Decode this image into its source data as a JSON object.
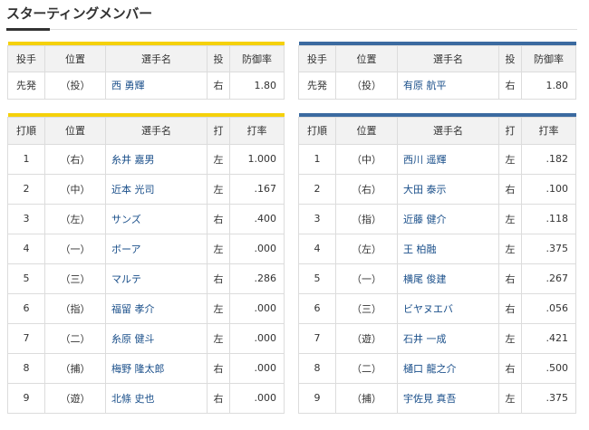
{
  "page": {
    "title": "スターティングメンバー"
  },
  "colors": {
    "home": "#f5d10a",
    "away": "#3b6aa0"
  },
  "pitchers": {
    "headers": [
      "投手",
      "位置",
      "選手名",
      "投",
      "防御率"
    ],
    "home": [
      [
        "先発",
        "（投）",
        "西 勇輝",
        "右",
        "1.80"
      ]
    ],
    "away": [
      [
        "先発",
        "（投）",
        "有原 航平",
        "右",
        "1.80"
      ]
    ]
  },
  "lineup": {
    "headers": [
      "打順",
      "位置",
      "選手名",
      "打",
      "打率"
    ],
    "home": [
      [
        "1",
        "（右）",
        "糸井 嘉男",
        "左",
        "1.000"
      ],
      [
        "2",
        "（中）",
        "近本 光司",
        "左",
        ".167"
      ],
      [
        "3",
        "（左）",
        "サンズ",
        "右",
        ".400"
      ],
      [
        "4",
        "（一）",
        "ボーア",
        "左",
        ".000"
      ],
      [
        "5",
        "（三）",
        "マルテ",
        "右",
        ".286"
      ],
      [
        "6",
        "（指）",
        "福留 孝介",
        "左",
        ".000"
      ],
      [
        "7",
        "（二）",
        "糸原 健斗",
        "左",
        ".000"
      ],
      [
        "8",
        "（捕）",
        "梅野 隆太郎",
        "右",
        ".000"
      ],
      [
        "9",
        "（遊）",
        "北條 史也",
        "右",
        ".000"
      ]
    ],
    "away": [
      [
        "1",
        "（中）",
        "西川 遥輝",
        "左",
        ".182"
      ],
      [
        "2",
        "（右）",
        "大田 泰示",
        "右",
        ".100"
      ],
      [
        "3",
        "（指）",
        "近藤 健介",
        "左",
        ".118"
      ],
      [
        "4",
        "（左）",
        "王 柏融",
        "左",
        ".375"
      ],
      [
        "5",
        "（一）",
        "横尾 俊建",
        "右",
        ".267"
      ],
      [
        "6",
        "（三）",
        "ビヤヌエバ",
        "右",
        ".056"
      ],
      [
        "7",
        "（遊）",
        "石井 一成",
        "左",
        ".421"
      ],
      [
        "8",
        "（二）",
        "樋口 龍之介",
        "右",
        ".500"
      ],
      [
        "9",
        "（捕）",
        "宇佐見 真吾",
        "左",
        ".375"
      ]
    ]
  }
}
